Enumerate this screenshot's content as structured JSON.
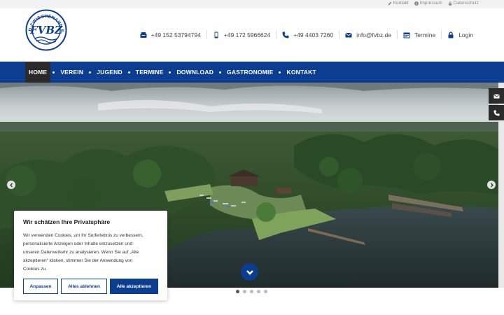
{
  "topbar": {
    "links": [
      {
        "label": "Kontakt",
        "icon": "pencil-icon"
      },
      {
        "label": "Impressum",
        "icon": "info-icon"
      },
      {
        "label": "Datenschutz",
        "icon": "lock-icon"
      }
    ]
  },
  "logo": {
    "top_text": "BAD ZWISCHENAHN E.V.",
    "monogram": "FVBZ"
  },
  "contacts": [
    {
      "label": "+49 152 53794794",
      "icon": "phone-fax-icon"
    },
    {
      "label": "+49 172 5966624",
      "icon": "mobile-icon"
    },
    {
      "label": "+49 4403 7260",
      "icon": "phone-icon"
    },
    {
      "label": "info@fvbz.de",
      "icon": "envelope-icon"
    },
    {
      "label": "Termine",
      "icon": "calendar-icon"
    },
    {
      "label": "Login",
      "icon": "lock-icon"
    }
  ],
  "nav": {
    "items": [
      {
        "label": "HOME"
      },
      {
        "label": "VEREIN"
      },
      {
        "label": "JUGEND"
      },
      {
        "label": "TERMINE"
      },
      {
        "label": "DOWNLOAD"
      },
      {
        "label": "GASTRONOMIE"
      },
      {
        "label": "KONTAKT"
      }
    ]
  },
  "slider": {
    "slide_count": 5,
    "active_slide": 1
  },
  "cookie": {
    "title": "Wir schätzen Ihre Privatsphäre",
    "lines": [
      "Wir verwenden Cookies, um Ihr Surferlebnis zu verbessern,",
      "personalisierte Anzeigen oder Inhalte einzusetzen und",
      "unseren Datenverkehr zu analysieren. Wenn Sie auf „Alle",
      "akzeptieren“ klicken, stimmen Sie der Anwendung von",
      "Cookies zu."
    ],
    "btn_customize": "Anpassen",
    "btn_reject": "Alles ablehnen",
    "btn_accept": "Alle akzeptieren"
  },
  "colors": {
    "brand_blue": "#0b3d91",
    "nav_active": "#2a2a2a"
  }
}
